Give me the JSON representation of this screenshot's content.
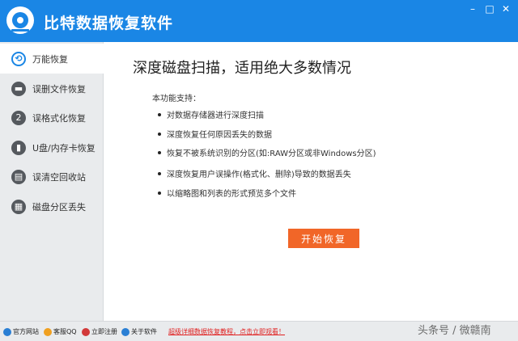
{
  "app": {
    "title": "比特数据恢复软件",
    "window_controls": {
      "minimize": "–",
      "maximize": "□",
      "close": "✕"
    }
  },
  "sidebar": {
    "items": [
      {
        "label": "万能恢复",
        "icon": "refresh-icon",
        "glyph": "⟲",
        "active": true
      },
      {
        "label": "误删文件恢复",
        "icon": "folder-icon",
        "glyph": "▬",
        "active": false
      },
      {
        "label": "误格式化恢复",
        "icon": "format-icon",
        "glyph": "2",
        "active": false
      },
      {
        "label": "U盘/内存卡恢复",
        "icon": "usb-icon",
        "glyph": "▮",
        "active": false
      },
      {
        "label": "误清空回收站",
        "icon": "recycle-bin-icon",
        "glyph": "▤",
        "active": false
      },
      {
        "label": "磁盘分区丢失",
        "icon": "disk-partition-icon",
        "glyph": "▦",
        "active": false
      }
    ]
  },
  "main": {
    "heading": "深度磁盘扫描，适用绝大多数情况",
    "support_label": "本功能支持：",
    "features": [
      "对数据存储器进行深度扫描",
      "深度恢复任何原因丢失的数据",
      "恢复不被系统识别的分区(如:RAW分区或非Windows分区)",
      "深度恢复用户误操作(格式化、删除)导致的数据丢失",
      "以缩略图和列表的形式预览多个文件"
    ],
    "start_button": "开始恢复"
  },
  "statusbar": {
    "links": [
      {
        "label": "官方网站",
        "icon": "globe-icon",
        "color": "#2a7fd4"
      },
      {
        "label": "客服QQ",
        "icon": "qq-icon",
        "color": "#f0a020"
      },
      {
        "label": "立即注册",
        "icon": "register-icon",
        "color": "#d23a3a"
      },
      {
        "label": "关于软件",
        "icon": "info-icon",
        "color": "#2a7fd4"
      }
    ],
    "promo": "超级详细数据恢复教程，点击立即观看！"
  },
  "watermark": "头条号 / 微赣南",
  "colors": {
    "titlebar": "#1a86e5",
    "accent": "#1a86e5",
    "start_button": "#f16628",
    "promo": "#e02020"
  }
}
